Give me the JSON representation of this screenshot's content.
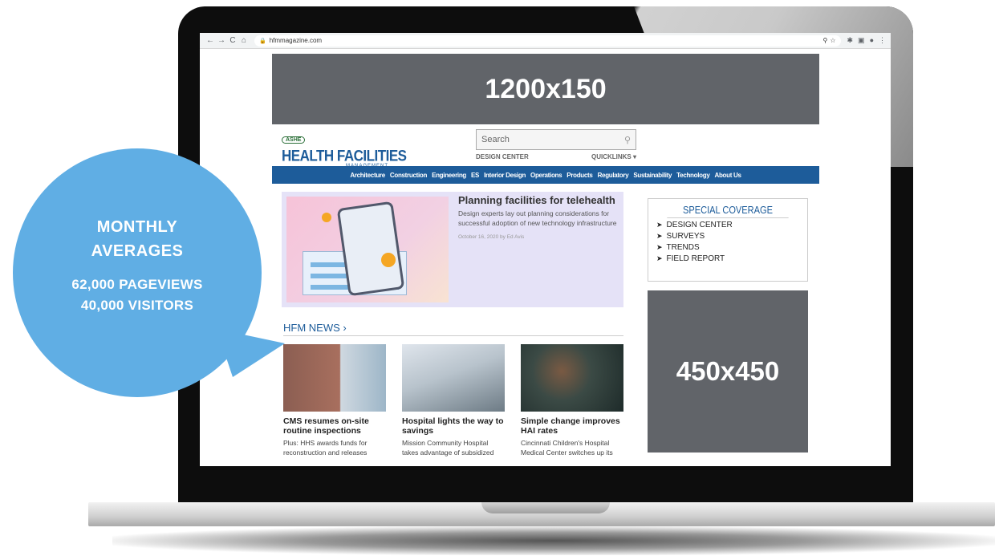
{
  "browser": {
    "url": "hfmmagazine.com",
    "nav_back": "←",
    "nav_forward": "→",
    "nav_reload": "C",
    "nav_home": "⌂",
    "icons": [
      "zoom-icon",
      "star-icon",
      "extensions-icon",
      "cast-icon",
      "profile-icon",
      "menu-icon"
    ]
  },
  "ads": {
    "top": "1200x150",
    "side": "450x450"
  },
  "site": {
    "logo_ashe": "ASHE",
    "logo_name": "HEALTH FACILITIES",
    "logo_sub": "MANAGEMENT",
    "search_placeholder": "Search",
    "design_center": "DESIGN CENTER",
    "quicklinks": "QUICKLINKS ▾"
  },
  "nav": [
    "Architecture",
    "Construction",
    "Engineering",
    "ES",
    "Interior Design",
    "Operations",
    "Products",
    "Regulatory",
    "Sustainability",
    "Technology",
    "About Us"
  ],
  "feature": {
    "title": "Planning facilities for telehealth",
    "desc": "Design experts lay out planning considerations for successful adoption of new technology infrastructure",
    "date": "October 16, 2020 by Ed Avis"
  },
  "special": {
    "title": "SPECIAL COVERAGE",
    "items": [
      "DESIGN CENTER",
      "SURVEYS",
      "TRENDS",
      "FIELD REPORT"
    ]
  },
  "news": {
    "heading": "HFM NEWS ›",
    "cards": [
      {
        "title": "CMS resumes on-site routine inspections",
        "desc": "Plus: HHS awards funds for reconstruction and releases"
      },
      {
        "title": "Hospital lights the way to savings",
        "desc": "Mission Community Hospital takes advantage of subsidized"
      },
      {
        "title": "Simple change improves HAI rates",
        "desc": "Cincinnati Children's Hospital Medical Center switches up its"
      }
    ]
  },
  "callout": {
    "title_line1": "MONTHLY",
    "title_line2": "AVERAGES",
    "stat1": "62,000 PAGEVIEWS",
    "stat2": "40,000 VISITORS"
  },
  "colors": {
    "brand_blue": "#1d5c9a",
    "ad_gray": "#616469",
    "callout_blue": "#60aee4",
    "feature_bg": "#e5e2f7"
  }
}
